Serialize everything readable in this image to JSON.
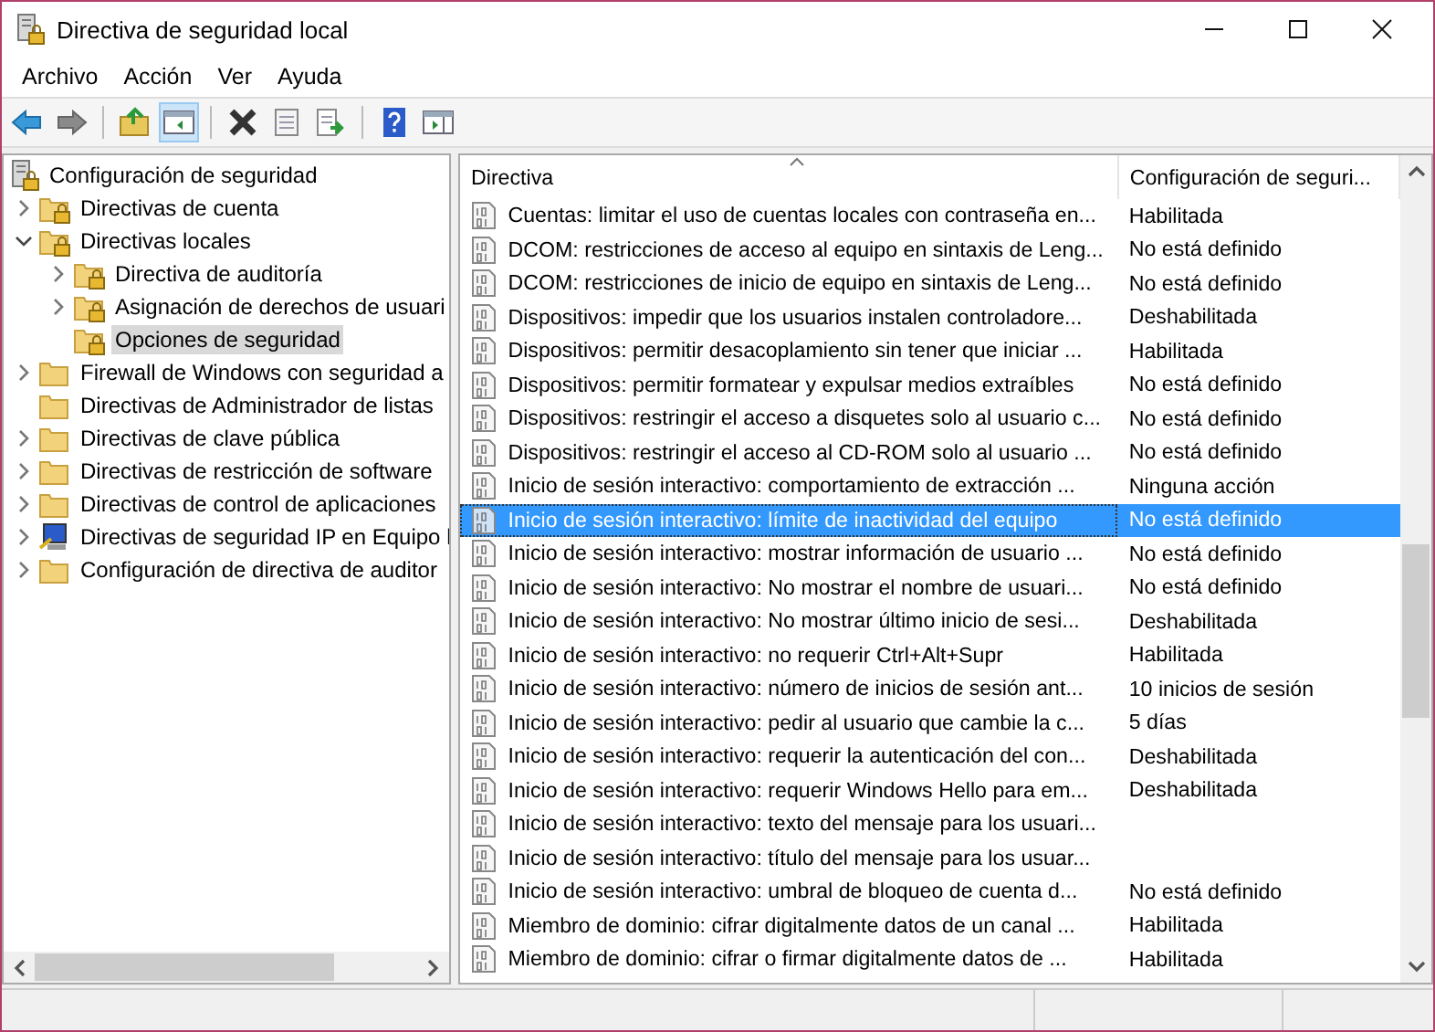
{
  "window": {
    "title": "Directiva de seguridad local"
  },
  "menu": [
    {
      "label": "Archivo"
    },
    {
      "label": "Acción"
    },
    {
      "label": "Ver"
    },
    {
      "label": "Ayuda"
    }
  ],
  "toolbar": [
    [
      {
        "kind": "back",
        "pressed": false
      },
      {
        "kind": "forward",
        "pressed": false
      }
    ],
    [
      {
        "kind": "up",
        "pressed": false
      },
      {
        "kind": "tree",
        "pressed": true
      }
    ],
    [
      {
        "kind": "delete",
        "pressed": false
      },
      {
        "kind": "properties",
        "pressed": false
      },
      {
        "kind": "export",
        "pressed": false
      }
    ],
    [
      {
        "kind": "help",
        "pressed": false
      },
      {
        "kind": "actionpane",
        "pressed": false
      }
    ]
  ],
  "tree": {
    "label": "Configuración de seguridad",
    "kind": "root",
    "selected": false,
    "children": [
      {
        "label": "Directivas de cuenta",
        "kind": "lockfolder",
        "expanded": false,
        "selected": false
      },
      {
        "label": "Directivas locales",
        "kind": "lockfolder",
        "expanded": true,
        "selected": false,
        "children": [
          {
            "label": "Directiva de auditoría",
            "kind": "lockfolder",
            "expanded": false,
            "selected": false
          },
          {
            "label": "Asignación de derechos de usuari",
            "kind": "lockfolder",
            "expanded": false,
            "selected": false
          },
          {
            "label": "Opciones de seguridad",
            "kind": "lockfolder",
            "selected": true
          }
        ]
      },
      {
        "label": "Firewall de Windows con seguridad a",
        "kind": "folder",
        "expanded": false,
        "selected": false
      },
      {
        "label": "Directivas de Administrador de listas",
        "kind": "folder",
        "selected": false
      },
      {
        "label": "Directivas de clave pública",
        "kind": "folder",
        "expanded": false,
        "selected": false
      },
      {
        "label": "Directivas de restricción de software",
        "kind": "folder",
        "expanded": false,
        "selected": false
      },
      {
        "label": "Directivas de control de aplicaciones",
        "kind": "folder",
        "expanded": false,
        "selected": false
      },
      {
        "label": "Directivas de seguridad IP en Equipo l",
        "kind": "network",
        "expanded": false,
        "selected": false
      },
      {
        "label": "Configuración de directiva de auditor",
        "kind": "folder",
        "expanded": false,
        "selected": false
      }
    ]
  },
  "table": {
    "columns": [
      "Directiva",
      "Configuración de seguri..."
    ],
    "rows": [
      {
        "policy": "Cuentas: limitar el uso de cuentas locales con contraseña en...",
        "setting": "Habilitada",
        "selected": false
      },
      {
        "policy": "DCOM: restricciones de acceso al equipo en sintaxis de Leng...",
        "setting": "No está definido",
        "selected": false
      },
      {
        "policy": "DCOM: restricciones de inicio de equipo en sintaxis de Leng...",
        "setting": "No está definido",
        "selected": false
      },
      {
        "policy": "Dispositivos: impedir que los usuarios instalen controladore...",
        "setting": "Deshabilitada",
        "selected": false
      },
      {
        "policy": "Dispositivos: permitir desacoplamiento sin tener que iniciar ...",
        "setting": "Habilitada",
        "selected": false
      },
      {
        "policy": "Dispositivos: permitir formatear y expulsar medios extraíbles",
        "setting": "No está definido",
        "selected": false
      },
      {
        "policy": "Dispositivos: restringir el acceso a disquetes solo al usuario c...",
        "setting": "No está definido",
        "selected": false
      },
      {
        "policy": "Dispositivos: restringir el acceso al CD-ROM solo al usuario ...",
        "setting": "No está definido",
        "selected": false
      },
      {
        "policy": "Inicio de sesión interactivo: comportamiento de extracción ...",
        "setting": "Ninguna acción",
        "selected": false
      },
      {
        "policy": "Inicio de sesión interactivo: límite de inactividad del equipo",
        "setting": "No está definido",
        "selected": true
      },
      {
        "policy": "Inicio de sesión interactivo: mostrar información de usuario ...",
        "setting": "No está definido",
        "selected": false
      },
      {
        "policy": "Inicio de sesión interactivo: No mostrar el nombre de usuari...",
        "setting": "No está definido",
        "selected": false
      },
      {
        "policy": "Inicio de sesión interactivo: No mostrar último inicio de sesi...",
        "setting": "Deshabilitada",
        "selected": false
      },
      {
        "policy": "Inicio de sesión interactivo: no requerir Ctrl+Alt+Supr",
        "setting": "Habilitada",
        "selected": false
      },
      {
        "policy": "Inicio de sesión interactivo: número de inicios de sesión ant...",
        "setting": "10 inicios de sesión",
        "selected": false
      },
      {
        "policy": "Inicio de sesión interactivo: pedir al usuario que cambie la c...",
        "setting": "5 días",
        "selected": false
      },
      {
        "policy": "Inicio de sesión interactivo: requerir la autenticación del con...",
        "setting": "Deshabilitada",
        "selected": false
      },
      {
        "policy": "Inicio de sesión interactivo: requerir Windows Hello para em...",
        "setting": "Deshabilitada",
        "selected": false
      },
      {
        "policy": "Inicio de sesión interactivo: texto del mensaje para los usuari...",
        "selected": false
      },
      {
        "policy": "Inicio de sesión interactivo: título del mensaje para los usuar...",
        "selected": false
      },
      {
        "policy": "Inicio de sesión interactivo: umbral de bloqueo de cuenta d...",
        "setting": "No está definido",
        "selected": false
      },
      {
        "policy": "Miembro de dominio: cifrar digitalmente datos de un canal ...",
        "setting": "Habilitada",
        "selected": false
      },
      {
        "policy": "Miembro de dominio: cifrar o firmar digitalmente datos de ...",
        "setting": "Habilitada",
        "selected": false
      }
    ]
  }
}
